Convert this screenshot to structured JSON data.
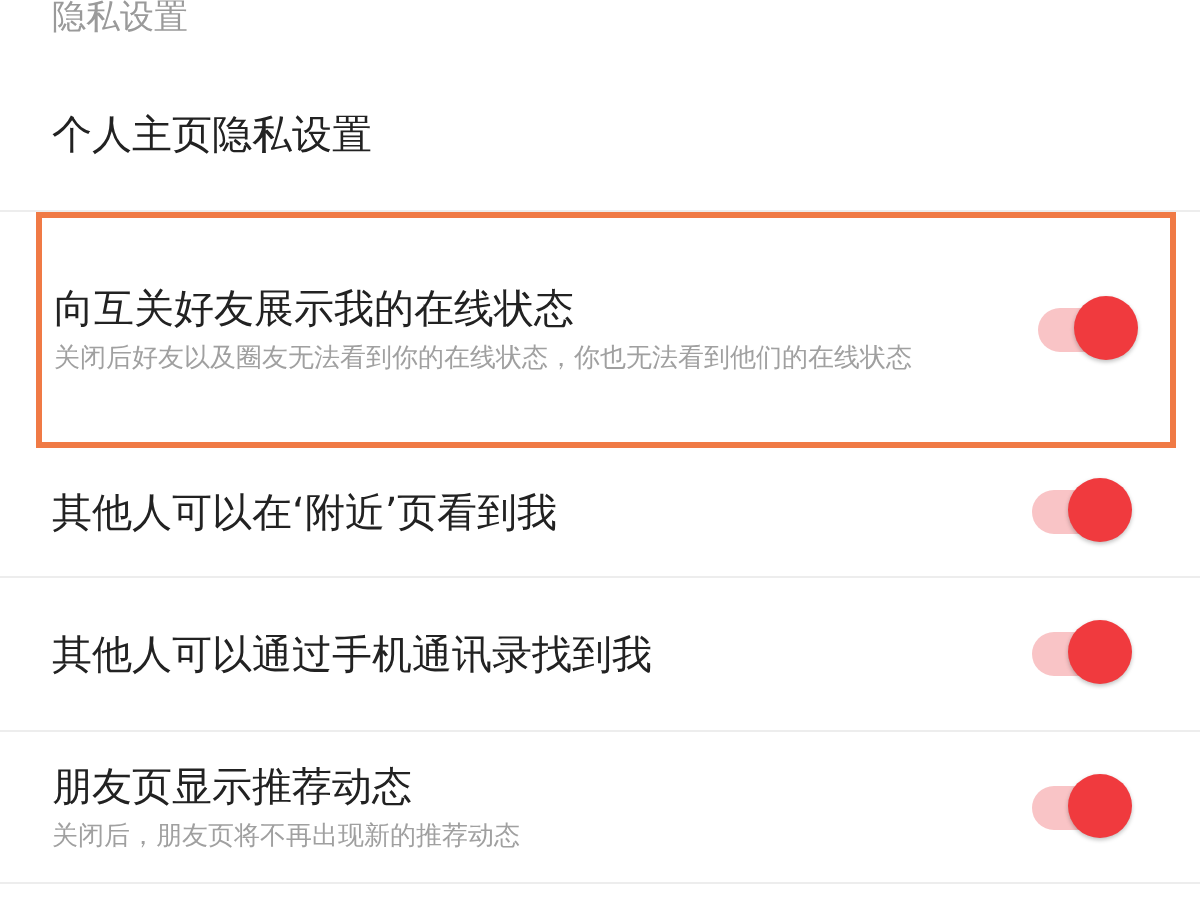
{
  "section_header": "隐私设置",
  "items": [
    {
      "kind": "link",
      "title": "个人主页隐私设置",
      "highlighted": false
    },
    {
      "kind": "toggle",
      "title": "向互关好友展示我的在线状态",
      "subtitle": "关闭后好友以及圈友无法看到你的在线状态，你也无法看到他们的在线状态",
      "on": true,
      "highlighted": true
    },
    {
      "kind": "toggle",
      "title": "其他人可以在‘附近’页看到我",
      "on": true,
      "highlighted": false
    },
    {
      "kind": "toggle",
      "title": "其他人可以通过手机通讯录找到我",
      "on": true,
      "highlighted": false
    },
    {
      "kind": "toggle",
      "title": "朋友页显示推荐动态",
      "subtitle": "关闭后，朋友页将不再出现新的推荐动态",
      "on": true,
      "highlighted": false
    }
  ]
}
